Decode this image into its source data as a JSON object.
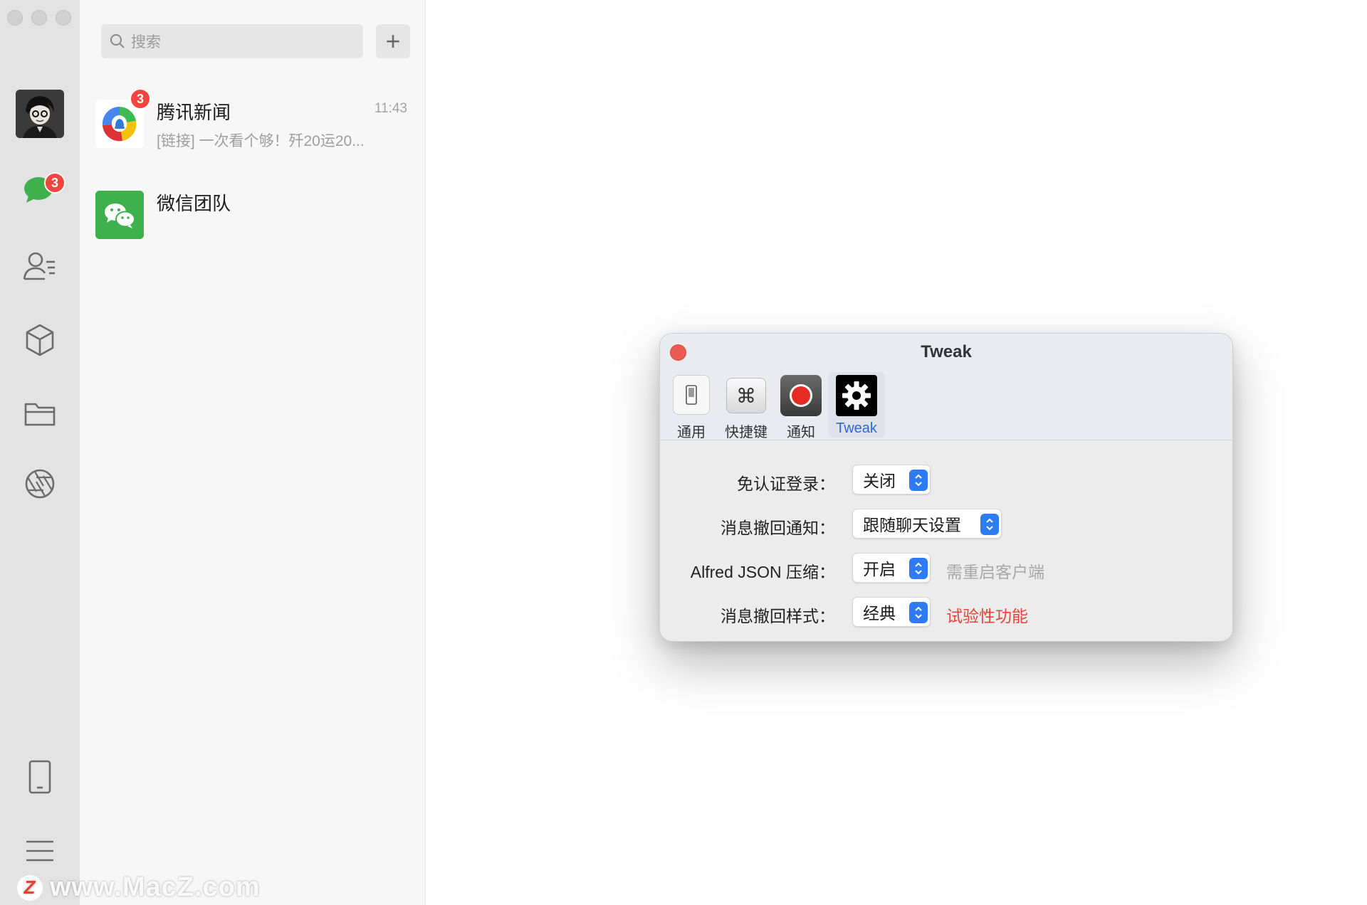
{
  "search": {
    "placeholder": "搜索"
  },
  "add_label": "+",
  "sidebar": {
    "chat_badge": "3"
  },
  "chats": [
    {
      "name": "腾讯新闻",
      "time": "11:43",
      "preview": "[链接] 一次看个够！歼20运20...",
      "badge": "3"
    },
    {
      "name": "微信团队",
      "time": "",
      "preview": ""
    }
  ],
  "dialog": {
    "title": "Tweak",
    "toolbar": [
      {
        "label": "通用",
        "icon": "switch-icon",
        "active": false
      },
      {
        "label": "快捷键",
        "icon": "command-key-icon",
        "active": false
      },
      {
        "label": "通知",
        "icon": "record-icon",
        "active": false
      },
      {
        "label": "Tweak",
        "icon": "gear-icon",
        "active": true
      }
    ],
    "settings": [
      {
        "label": "免认证登录：",
        "value": "关闭",
        "note": ""
      },
      {
        "label": "消息撤回通知：",
        "value": "跟随聊天设置",
        "note": ""
      },
      {
        "label": "Alfred JSON 压缩：",
        "value": "开启",
        "note": "需重启客户端"
      },
      {
        "label": "消息撤回样式：",
        "value": "经典",
        "note": "试验性功能"
      }
    ]
  },
  "watermark": {
    "text": "www.MacZ.com",
    "logo": "Z"
  },
  "colors": {
    "badge": "#f2453d",
    "wechat_green": "#3fb14c",
    "accent": "#2e7bf6",
    "warning": "#e2453c",
    "muted": "#a8a8a8"
  }
}
